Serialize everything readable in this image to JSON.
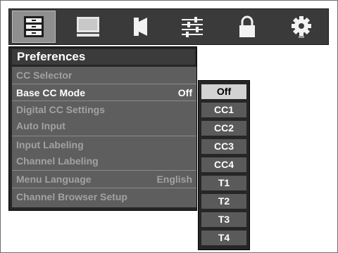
{
  "icons": [
    {
      "name": "setup-icon",
      "selected": true
    },
    {
      "name": "picture-icon",
      "selected": false
    },
    {
      "name": "audio-icon",
      "selected": false
    },
    {
      "name": "adjust-icon",
      "selected": false
    },
    {
      "name": "lock-icon",
      "selected": false
    },
    {
      "name": "gear-icon",
      "selected": false
    }
  ],
  "preferences": {
    "title": "Preferences",
    "items": [
      {
        "label": "CC Selector",
        "value": ""
      },
      {
        "label": "Base CC Mode",
        "value": "Off"
      },
      {
        "label": "Digital CC Settings",
        "value": ""
      },
      {
        "label": "Auto Input",
        "value": ""
      },
      {
        "label": "Input Labeling",
        "value": ""
      },
      {
        "label": "Channel Labeling",
        "value": ""
      },
      {
        "label": "Menu Language",
        "value": "English"
      },
      {
        "label": "Channel Browser Setup",
        "value": ""
      }
    ]
  },
  "cc_mode_list": {
    "selected": "Off",
    "options": [
      "Off",
      "CC1",
      "CC2",
      "CC3",
      "CC4",
      "T1",
      "T2",
      "T3",
      "T4"
    ]
  },
  "colors": {
    "panel_dark": "#262626",
    "panel_body": "#5e5e5e",
    "text_active": "#ffffff",
    "text_inactive": "#a2a2a2",
    "highlight": "#d2d2d2"
  }
}
